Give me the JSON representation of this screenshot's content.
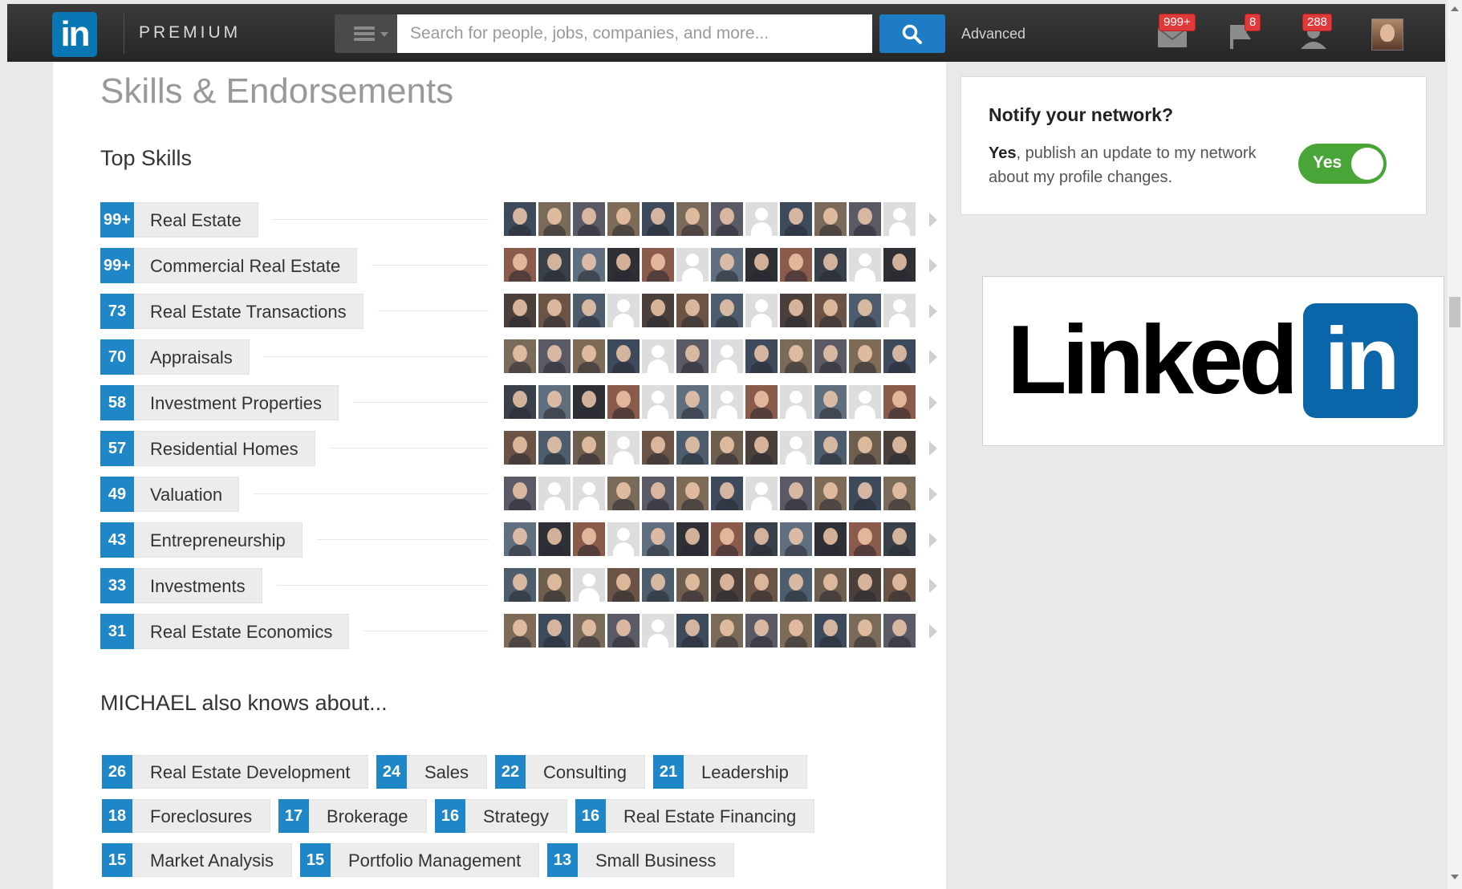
{
  "nav": {
    "logo": "in",
    "premium": "PREMIUM",
    "search_placeholder": "Search for people, jobs, companies, and more...",
    "advanced": "Advanced",
    "badges": {
      "messages": "999+",
      "notifications": "8",
      "invitations": "288"
    }
  },
  "main": {
    "section_title": "Skills & Endorsements",
    "top_skills_title": "Top Skills",
    "also_title": "MICHAEL also knows about...",
    "top_skills": [
      {
        "count": "99+",
        "name": "Real Estate",
        "endorsers": [
          1,
          1,
          1,
          1,
          1,
          1,
          1,
          0,
          1,
          1,
          1,
          0
        ]
      },
      {
        "count": "99+",
        "name": "Commercial Real Estate",
        "endorsers": [
          1,
          1,
          1,
          1,
          1,
          0,
          1,
          1,
          1,
          1,
          0,
          1
        ]
      },
      {
        "count": "73",
        "name": "Real Estate Transactions",
        "endorsers": [
          1,
          1,
          1,
          0,
          1,
          1,
          1,
          0,
          1,
          1,
          1,
          0
        ]
      },
      {
        "count": "70",
        "name": "Appraisals",
        "endorsers": [
          1,
          1,
          1,
          1,
          0,
          1,
          0,
          1,
          1,
          1,
          1,
          1
        ]
      },
      {
        "count": "58",
        "name": "Investment Properties",
        "endorsers": [
          1,
          1,
          1,
          1,
          0,
          1,
          0,
          1,
          0,
          1,
          0,
          1
        ]
      },
      {
        "count": "57",
        "name": "Residential Homes",
        "endorsers": [
          1,
          1,
          1,
          0,
          1,
          1,
          1,
          1,
          0,
          1,
          1,
          1
        ]
      },
      {
        "count": "49",
        "name": "Valuation",
        "endorsers": [
          1,
          0,
          0,
          1,
          1,
          1,
          1,
          0,
          1,
          1,
          1,
          1
        ]
      },
      {
        "count": "43",
        "name": "Entrepreneurship",
        "endorsers": [
          1,
          1,
          1,
          0,
          1,
          1,
          1,
          1,
          1,
          1,
          1,
          1
        ]
      },
      {
        "count": "33",
        "name": "Investments",
        "endorsers": [
          1,
          1,
          0,
          1,
          1,
          1,
          1,
          1,
          1,
          1,
          1,
          1
        ]
      },
      {
        "count": "31",
        "name": "Real Estate Economics",
        "endorsers": [
          1,
          1,
          1,
          1,
          0,
          1,
          1,
          1,
          1,
          1,
          1,
          1
        ]
      }
    ],
    "other_skills": [
      [
        {
          "count": "26",
          "name": "Real Estate Development"
        },
        {
          "count": "24",
          "name": "Sales"
        },
        {
          "count": "22",
          "name": "Consulting"
        },
        {
          "count": "21",
          "name": "Leadership"
        }
      ],
      [
        {
          "count": "18",
          "name": "Foreclosures"
        },
        {
          "count": "17",
          "name": "Brokerage"
        },
        {
          "count": "16",
          "name": "Strategy"
        },
        {
          "count": "16",
          "name": "Real Estate Financing"
        }
      ],
      [
        {
          "count": "15",
          "name": "Market Analysis"
        },
        {
          "count": "15",
          "name": "Portfolio Management"
        },
        {
          "count": "13",
          "name": "Small Business"
        }
      ]
    ]
  },
  "notify": {
    "title": "Notify your network?",
    "text_bold": "Yes",
    "text_rest": ", publish an update to my network about my profile changes.",
    "toggle_label": "Yes"
  },
  "ad": {
    "word": "Linked",
    "badge": "in"
  },
  "colors": {
    "accent": "#1f87c8",
    "toggle_on": "#4aa539",
    "brand": "#0a66a8"
  }
}
